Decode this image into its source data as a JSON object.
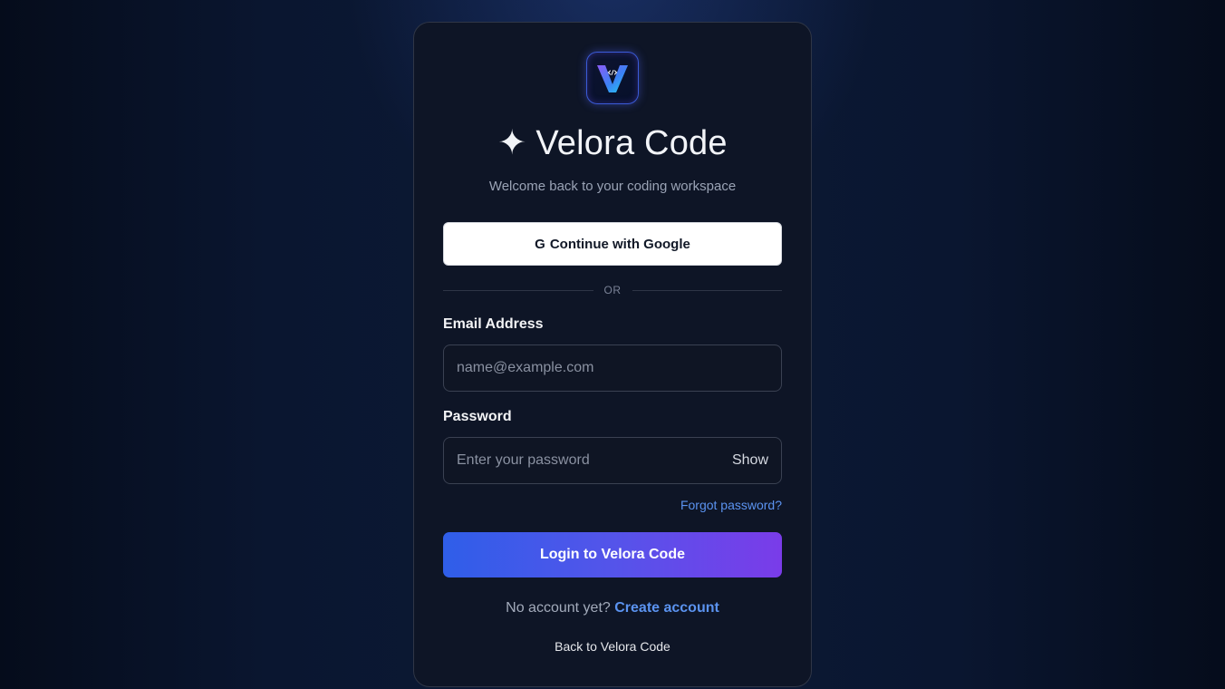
{
  "brand": {
    "logo_icon": "velora-v-logo-icon",
    "title_icon": "✦",
    "title": "Velora Code",
    "subtitle": "Welcome back to your coding workspace"
  },
  "google": {
    "icon": "G",
    "label": "Continue with Google"
  },
  "divider": {
    "text": "OR"
  },
  "email": {
    "label": "Email Address",
    "value": "",
    "placeholder": "name@example.com"
  },
  "password": {
    "label": "Password",
    "value": "",
    "placeholder": "Enter your password",
    "toggle_label": "Show"
  },
  "forgot_label": "Forgot password?",
  "login_label": "Login to Velora Code",
  "signup": {
    "prompt": "No account yet?",
    "link": "Create account"
  },
  "back_label": "Back to Velora Code",
  "colors": {
    "accent_blue": "#2f5ee9",
    "accent_purple": "#7a3ce9",
    "link": "#5b93f0",
    "card_bg": "#0e1526"
  }
}
